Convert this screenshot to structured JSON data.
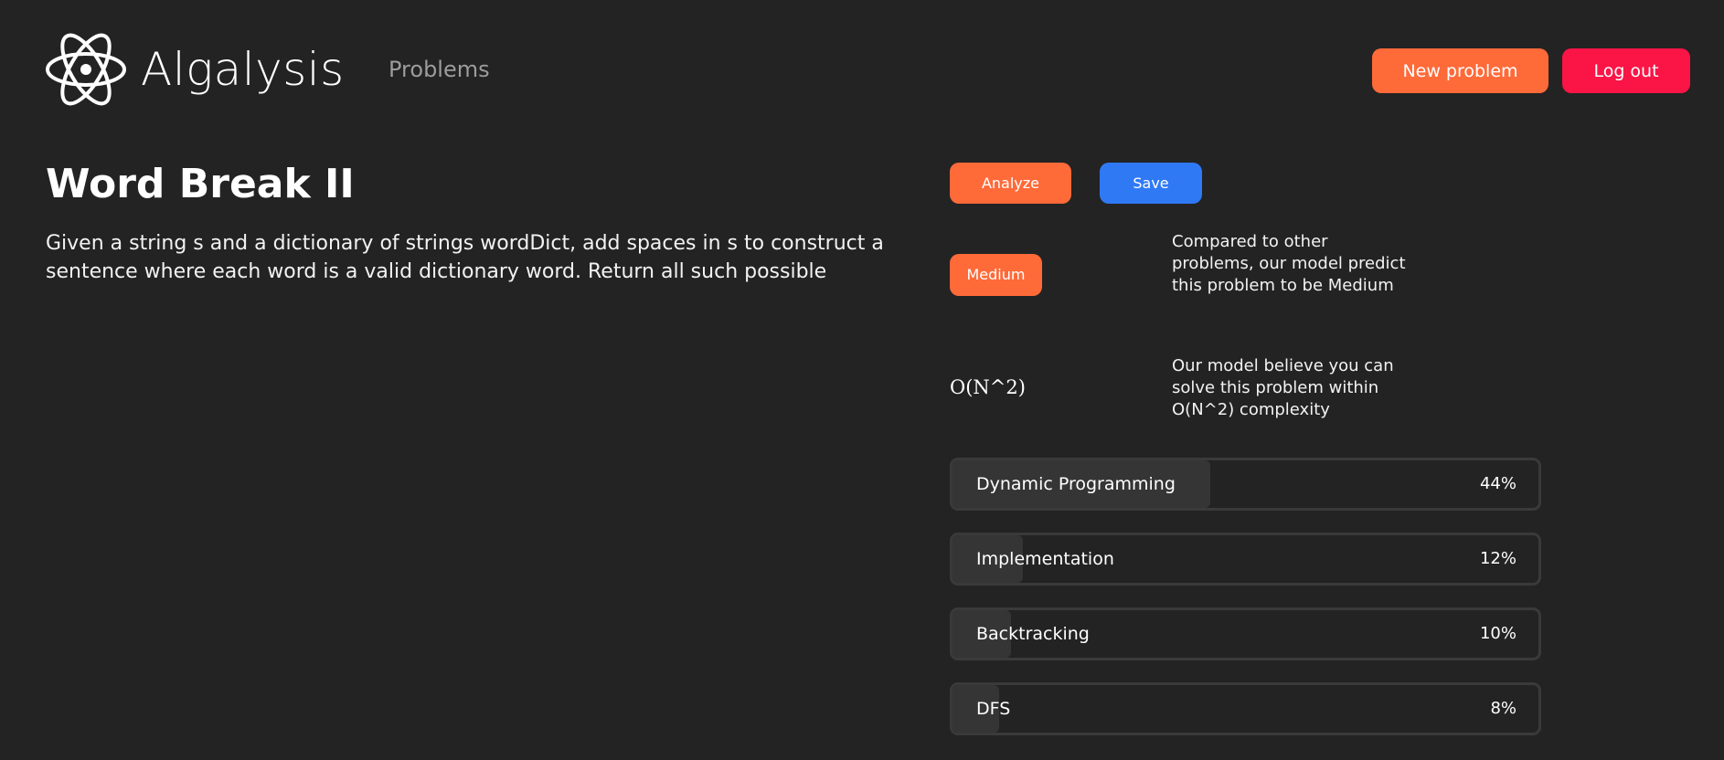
{
  "header": {
    "brand_name": "Algalysis",
    "logo_icon": "atom-icon",
    "nav_problems": "Problems",
    "new_problem_label": "New problem",
    "logout_label": "Log out"
  },
  "problem": {
    "title": "Word Break II",
    "description": "Given a string s and a dictionary of strings wordDict, add spaces in s to construct a sentence where each word is a valid dictionary word. Return all such possible"
  },
  "analysis": {
    "analyze_label": "Analyze",
    "save_label": "Save",
    "difficulty": "Medium",
    "difficulty_note": "Compared to other problems, our model predict this problem to be Medium",
    "complexity": "O(N^2)",
    "complexity_note": "Our model believe you can solve this problem within O(N^2) complexity",
    "tags": [
      {
        "name": "Dynamic Programming",
        "percent_label": "44%",
        "percent": 44
      },
      {
        "name": "Implementation",
        "percent_label": "12%",
        "percent": 12
      },
      {
        "name": "Backtracking",
        "percent_label": "10%",
        "percent": 10
      },
      {
        "name": "DFS",
        "percent_label": "8%",
        "percent": 8
      }
    ]
  },
  "colors": {
    "background": "#232323",
    "accent_orange": "#ff6a39",
    "logout_red": "#fb1446",
    "save_blue": "#2f79f5",
    "nav_gray": "#9c9c9c"
  }
}
